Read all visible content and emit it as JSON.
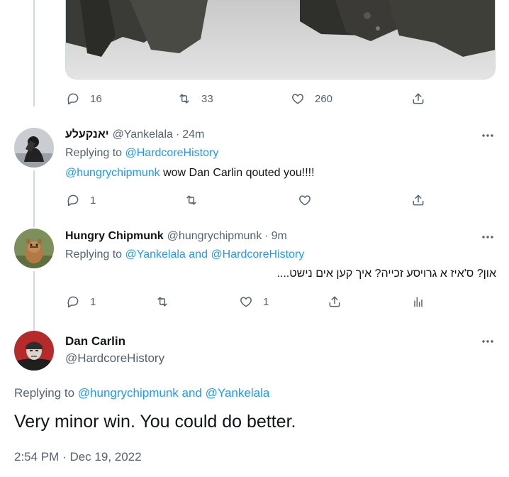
{
  "top_tweet": {
    "actions": {
      "replies": "16",
      "retweets": "33",
      "likes": "260"
    }
  },
  "reply1": {
    "name": "יאנקעלע",
    "handle": "@Yankelala",
    "time": "24m",
    "replying_label": "Replying to",
    "replying_to": "@HardcoreHistory",
    "mention": "@hungrychipmunk",
    "text": " wow Dan Carlin qouted you!!!!",
    "actions": {
      "replies": "1"
    }
  },
  "reply2": {
    "name": "Hungry Chipmunk",
    "handle": "@hungrychipmunk",
    "time": "9m",
    "replying_label": "Replying to",
    "replying_to_1": "@Yankelala",
    "and": "and",
    "replying_to_2": "@HardcoreHistory",
    "text": "און? ס'איז א גרויסע זכייה? איך קען אים נישט....",
    "actions": {
      "replies": "1",
      "likes": "1"
    }
  },
  "main_tweet": {
    "name": "Dan Carlin",
    "handle": "@HardcoreHistory",
    "replying_label": "Replying to",
    "replying_to_1": "@hungrychipmunk",
    "and": "and",
    "replying_to_2": "@Yankelala",
    "text": "Very minor win. You could do better.",
    "time": "2:54 PM",
    "date": "Dec 19, 2022"
  },
  "colors": {
    "accent": "#1d9bf0",
    "secondary_text": "#536471",
    "thread_line": "#cfd9de"
  }
}
